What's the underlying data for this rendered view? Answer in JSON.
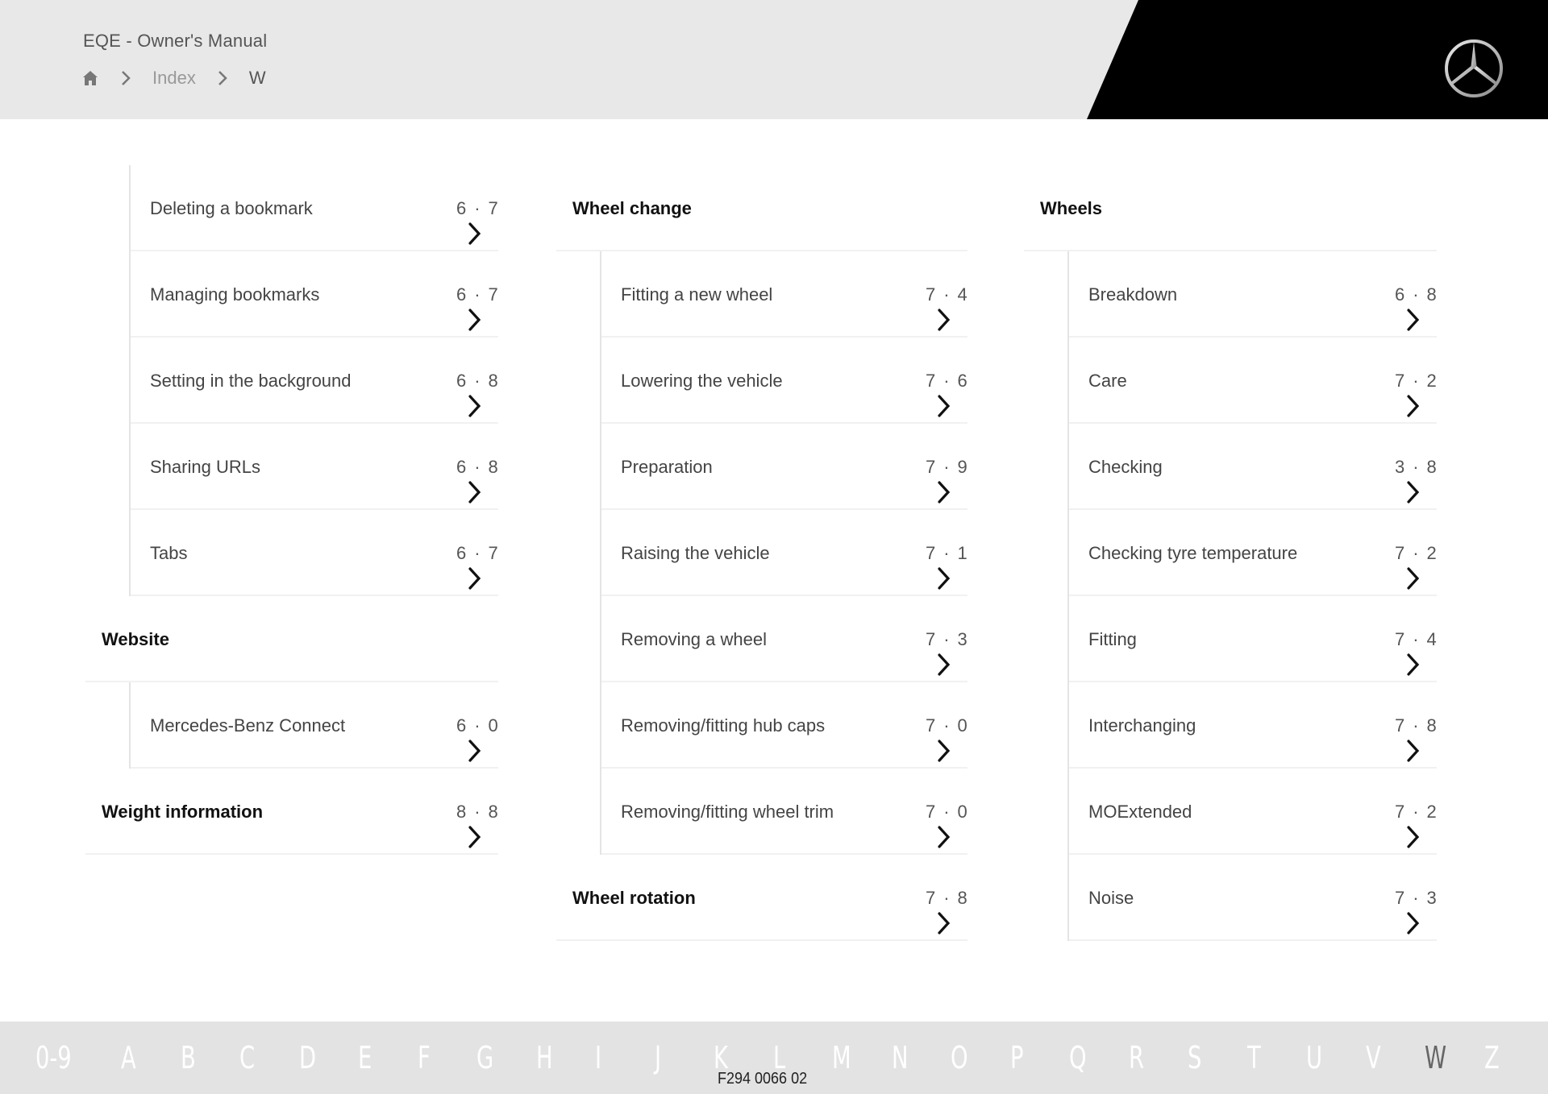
{
  "header": {
    "title": "EQE - Owner's Manual",
    "breadcrumb": {
      "home_icon": "home-icon",
      "separator_icon": "chevron-right-icon",
      "items": [
        "Index",
        "W"
      ]
    },
    "logo": "mercedes-star-logo"
  },
  "index": {
    "columns": [
      {
        "entries": [
          {
            "type": "sub",
            "label": "Deleting a bookmark",
            "page_visible": "6·7"
          },
          {
            "type": "sub",
            "label": "Managing bookmarks",
            "page_visible": "6·7"
          },
          {
            "type": "sub",
            "label": "Setting in the background",
            "page_visible": "6·8"
          },
          {
            "type": "sub",
            "label": "Sharing URLs",
            "page_visible": "6·8"
          },
          {
            "type": "sub",
            "label": "Tabs",
            "page_visible": "6·7"
          },
          {
            "type": "main",
            "label": "Website",
            "page_visible": ""
          },
          {
            "type": "sub",
            "label": "Mercedes-Benz Connect",
            "page_visible": "6·0"
          },
          {
            "type": "main",
            "label": "Weight information",
            "page_visible": "8·8"
          }
        ]
      },
      {
        "entries": [
          {
            "type": "main",
            "label": "Wheel change",
            "page_visible": ""
          },
          {
            "type": "sub",
            "label": "Fitting a new wheel",
            "page_visible": "7·4"
          },
          {
            "type": "sub",
            "label": "Lowering the vehicle",
            "page_visible": "7·6"
          },
          {
            "type": "sub",
            "label": "Preparation",
            "page_visible": "7·9"
          },
          {
            "type": "sub",
            "label": "Raising the vehicle",
            "page_visible": "7·1"
          },
          {
            "type": "sub",
            "label": "Removing a wheel",
            "page_visible": "7·3"
          },
          {
            "type": "sub",
            "label": "Removing/fitting hub caps",
            "page_visible": "7·0"
          },
          {
            "type": "sub",
            "label": "Removing/fitting wheel trim",
            "page_visible": "7·0"
          },
          {
            "type": "main",
            "label": "Wheel rotation",
            "page_visible": "7·8"
          }
        ]
      },
      {
        "entries": [
          {
            "type": "main",
            "label": "Wheels",
            "page_visible": ""
          },
          {
            "type": "sub",
            "label": "Breakdown",
            "page_visible": "6·8"
          },
          {
            "type": "sub",
            "label": "Care",
            "page_visible": "7·2"
          },
          {
            "type": "sub",
            "label": "Checking",
            "page_visible": "3·8"
          },
          {
            "type": "sub",
            "label": "Checking tyre temperature",
            "page_visible": "7·2"
          },
          {
            "type": "sub",
            "label": "Fitting",
            "page_visible": "7·4"
          },
          {
            "type": "sub",
            "label": "Interchanging",
            "page_visible": "7·8"
          },
          {
            "type": "sub",
            "label": "MOExtended",
            "page_visible": "7·2"
          },
          {
            "type": "sub",
            "label": "Noise",
            "page_visible": "7·3"
          }
        ]
      }
    ],
    "entry_link_icon": "chevron-right-icon"
  },
  "footer": {
    "alphabet": [
      "0-9",
      "A",
      "B",
      "C",
      "D",
      "E",
      "F",
      "G",
      "H",
      "I",
      "J",
      "K",
      "L",
      "M",
      "N",
      "O",
      "P",
      "Q",
      "R",
      "S",
      "T",
      "U",
      "V",
      "W",
      "Z"
    ],
    "active_letter": "W",
    "doc_code": "F294 0066 02"
  },
  "colors": {
    "header_bg": "#e8e8e8",
    "header_black": "#000000",
    "footer_bg": "#e3e3e3",
    "alphabet_inactive": "#ffffff",
    "alphabet_active": "#666666"
  }
}
